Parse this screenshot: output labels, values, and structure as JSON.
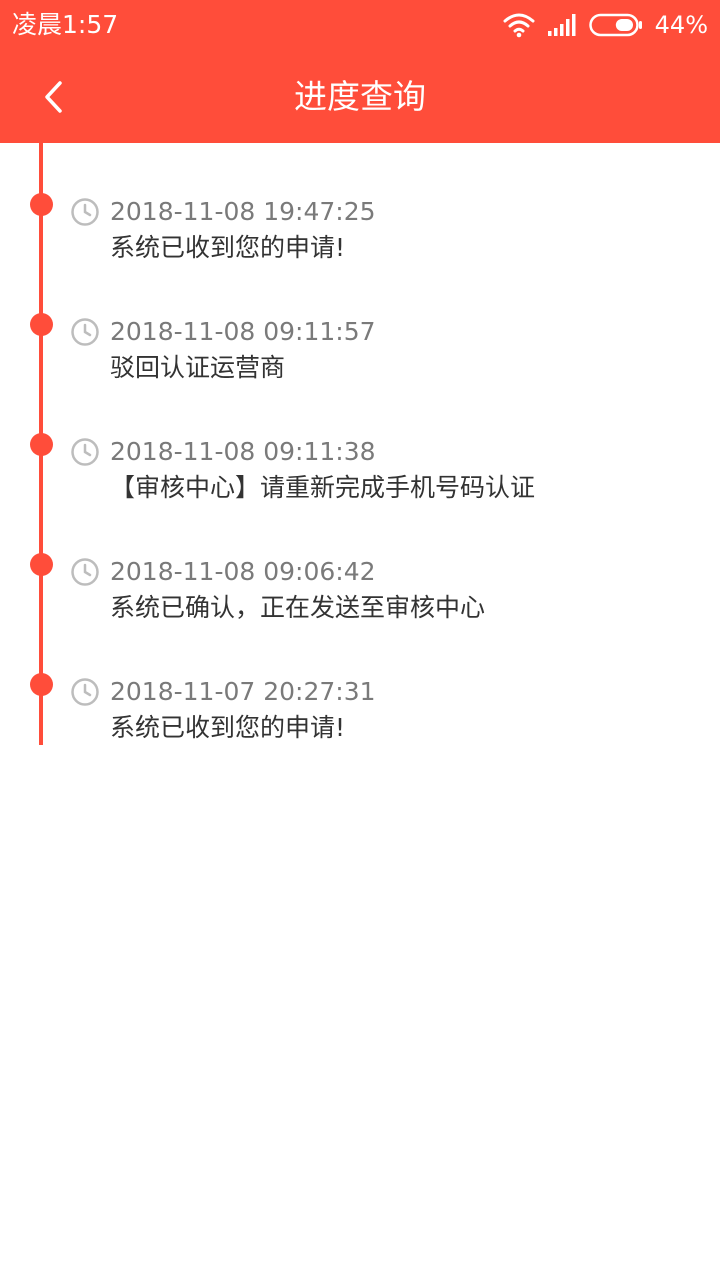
{
  "status_bar": {
    "time": "凌晨1:57",
    "battery_percent": "44%",
    "battery_level": 0.44,
    "icons": [
      "wifi-icon",
      "signal-icon",
      "battery-icon"
    ]
  },
  "header": {
    "title": "进度查询",
    "back_icon": "chevron-left-icon"
  },
  "colors": {
    "accent": "#FF4D3A",
    "time_text": "#7a7a7a",
    "body_text": "#333333",
    "clock_icon": "#bdbdbd"
  },
  "timeline": {
    "items": [
      {
        "time": "2018-11-08 19:47:25",
        "text": "系统已收到您的申请!"
      },
      {
        "time": "2018-11-08 09:11:57",
        "text": "驳回认证运营商"
      },
      {
        "time": "2018-11-08 09:11:38",
        "text": "【审核中心】请重新完成手机号码认证"
      },
      {
        "time": "2018-11-08 09:06:42",
        "text": "系统已确认，正在发送至审核中心"
      },
      {
        "time": "2018-11-07 20:27:31",
        "text": "系统已收到您的申请!"
      }
    ]
  }
}
